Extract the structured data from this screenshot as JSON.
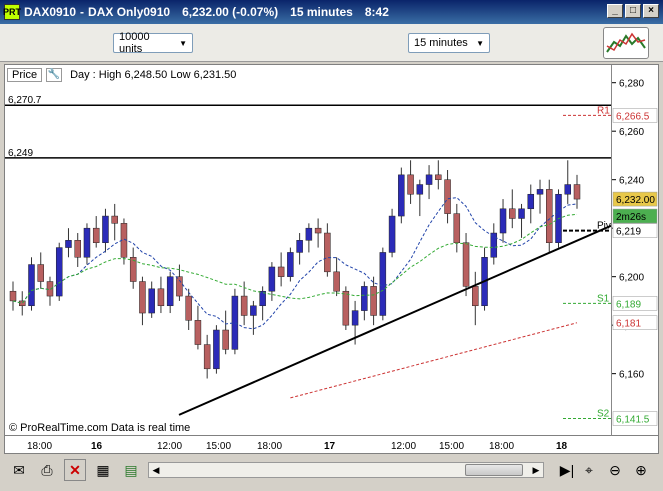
{
  "window": {
    "title_parts": [
      "DAX0910",
      "-",
      "DAX Only0910",
      "6,232.00 (-0.07%)",
      "15 minutes",
      "8:42"
    ],
    "app_icon_label": "PRT",
    "controls": [
      "minimize",
      "maximize",
      "close"
    ]
  },
  "toolbar": {
    "units_dropdown": "10000 units",
    "interval_dropdown": "15 minutes",
    "chart_button_icon": "chart-type-icon"
  },
  "chart_header": {
    "price_label": "Price",
    "wrench_icon": "wrench-icon",
    "day_info": "Day : High 6,248.50 Low 6,231.50"
  },
  "chart_data": {
    "type": "candlestick",
    "instrument": "DAX0910",
    "ylim": [
      6138,
      6284
    ],
    "y_ticks": [
      "6,280",
      "6,260",
      "6,240",
      "6,220",
      "6,200",
      "6,180",
      "6,160"
    ],
    "x_ticks": [
      "18:00",
      "16",
      "12:00",
      "15:00",
      "18:00",
      "17",
      "12:00",
      "15:00",
      "18:00",
      "18"
    ],
    "levels": [
      {
        "label": "6,270.7",
        "value": 6270.7,
        "style": "solid-black"
      },
      {
        "label": "6,249",
        "value": 6249,
        "style": "solid-black"
      }
    ],
    "pivots": [
      {
        "name": "R1",
        "value_label": "6,266.5",
        "value": 6266.5,
        "color": "#cc3333"
      },
      {
        "name": "Piv",
        "value_label": "6,219",
        "value": 6219,
        "color": "#000000"
      },
      {
        "name": "S1",
        "value_label": "6,189",
        "value": 6189,
        "color": "#33aa33"
      },
      {
        "name": "S2",
        "value_label": "6,141.5",
        "value": 6141.5,
        "color": "#33aa33"
      }
    ],
    "right_labels": [
      {
        "label": "6,232.00",
        "value": 6232,
        "bg": "#e8c84a"
      },
      {
        "label": "2m26s",
        "value": 6225,
        "bg": "#4caf50"
      },
      {
        "label": "6,181",
        "value": 6181,
        "bg": "#ffffff",
        "color": "#cc3333"
      }
    ],
    "candles": [
      [
        6194,
        6198,
        6186,
        6190
      ],
      [
        6190,
        6194,
        6184,
        6188
      ],
      [
        6188,
        6208,
        6186,
        6205
      ],
      [
        6205,
        6210,
        6195,
        6198
      ],
      [
        6198,
        6200,
        6188,
        6192
      ],
      [
        6192,
        6214,
        6190,
        6212
      ],
      [
        6212,
        6220,
        6208,
        6215
      ],
      [
        6215,
        6218,
        6204,
        6208
      ],
      [
        6208,
        6222,
        6205,
        6220
      ],
      [
        6220,
        6225,
        6212,
        6214
      ],
      [
        6214,
        6228,
        6210,
        6225
      ],
      [
        6225,
        6230,
        6215,
        6222
      ],
      [
        6222,
        6224,
        6205,
        6208
      ],
      [
        6208,
        6212,
        6195,
        6198
      ],
      [
        6198,
        6200,
        6180,
        6185
      ],
      [
        6185,
        6198,
        6183,
        6195
      ],
      [
        6195,
        6200,
        6185,
        6188
      ],
      [
        6188,
        6202,
        6185,
        6200
      ],
      [
        6200,
        6205,
        6190,
        6192
      ],
      [
        6192,
        6195,
        6178,
        6182
      ],
      [
        6182,
        6188,
        6170,
        6172
      ],
      [
        6172,
        6176,
        6158,
        6162
      ],
      [
        6162,
        6180,
        6160,
        6178
      ],
      [
        6178,
        6186,
        6168,
        6170
      ],
      [
        6170,
        6195,
        6168,
        6192
      ],
      [
        6192,
        6198,
        6180,
        6184
      ],
      [
        6184,
        6190,
        6176,
        6188
      ],
      [
        6188,
        6196,
        6182,
        6194
      ],
      [
        6194,
        6206,
        6190,
        6204
      ],
      [
        6204,
        6210,
        6196,
        6200
      ],
      [
        6200,
        6212,
        6198,
        6210
      ],
      [
        6210,
        6218,
        6205,
        6215
      ],
      [
        6215,
        6222,
        6210,
        6220
      ],
      [
        6220,
        6224,
        6212,
        6218
      ],
      [
        6218,
        6222,
        6200,
        6202
      ],
      [
        6202,
        6208,
        6192,
        6194
      ],
      [
        6194,
        6196,
        6178,
        6180
      ],
      [
        6180,
        6190,
        6172,
        6186
      ],
      [
        6186,
        6198,
        6182,
        6196
      ],
      [
        6196,
        6200,
        6180,
        6184
      ],
      [
        6184,
        6212,
        6182,
        6210
      ],
      [
        6210,
        6228,
        6208,
        6225
      ],
      [
        6225,
        6245,
        6222,
        6242
      ],
      [
        6242,
        6248,
        6230,
        6234
      ],
      [
        6234,
        6240,
        6225,
        6238
      ],
      [
        6238,
        6246,
        6232,
        6242
      ],
      [
        6242,
        6248,
        6236,
        6240
      ],
      [
        6240,
        6244,
        6222,
        6226
      ],
      [
        6226,
        6230,
        6210,
        6214
      ],
      [
        6214,
        6218,
        6192,
        6196
      ],
      [
        6196,
        6202,
        6180,
        6188
      ],
      [
        6188,
        6212,
        6186,
        6208
      ],
      [
        6208,
        6222,
        6205,
        6218
      ],
      [
        6218,
        6232,
        6214,
        6228
      ],
      [
        6228,
        6236,
        6220,
        6224
      ],
      [
        6224,
        6230,
        6216,
        6228
      ],
      [
        6228,
        6238,
        6222,
        6234
      ],
      [
        6234,
        6240,
        6226,
        6236
      ],
      [
        6236,
        6240,
        6210,
        6214
      ],
      [
        6214,
        6236,
        6212,
        6234
      ],
      [
        6234,
        6248,
        6230,
        6238
      ],
      [
        6238,
        6242,
        6228,
        6232
      ]
    ]
  },
  "footer": {
    "copyright": "© ProRealTime.com  Data is real time"
  },
  "bottom_toolbar": {
    "icons": [
      "mail-icon",
      "print-icon",
      "close-chart-icon",
      "grid-icon",
      "indicators-icon",
      "layout-icon"
    ],
    "right_icons": [
      "zoom-fit-icon",
      "zoom-out-icon",
      "zoom-in-icon"
    ]
  }
}
